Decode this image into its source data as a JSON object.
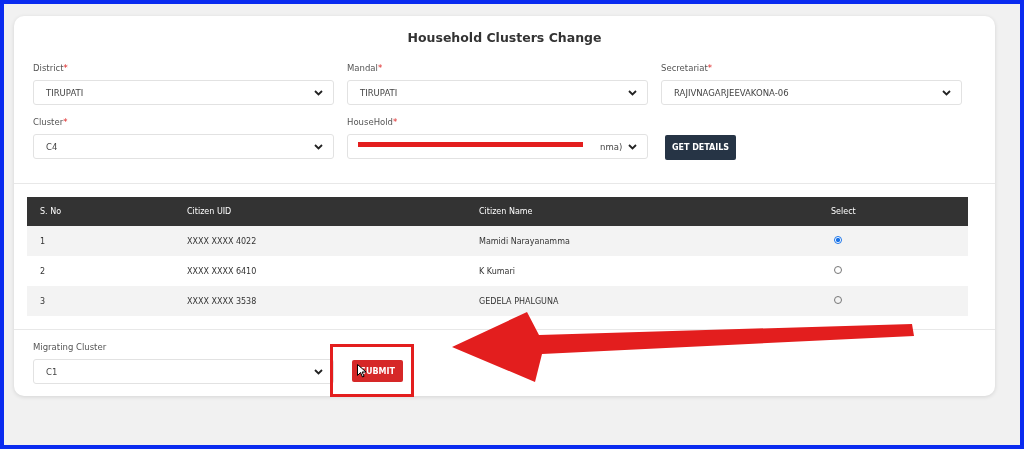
{
  "title": "Household Clusters Change",
  "filters": [
    {
      "label": "District",
      "required_mark": "*",
      "value": "TIRUPATI"
    },
    {
      "label": "Mandal",
      "required_mark": "*",
      "value": "TIRUPATI"
    },
    {
      "label": "Secretariat",
      "required_mark": "*",
      "value": "RAJIVNAGARJEEVAKONA-06"
    },
    {
      "label": "Cluster",
      "required_mark": "*",
      "value": "C4"
    },
    {
      "label": "HouseHold",
      "required_mark": "*",
      "value": "nma)",
      "redacted": true
    }
  ],
  "get_details_button": "GET DETAILS",
  "table": {
    "columns": [
      "S. No",
      "Citizen UID",
      "Citizen Name",
      "Select"
    ],
    "rows": [
      {
        "sno": "1",
        "uid": "XXXX XXXX 4022",
        "name": "Mamidi Narayanamma",
        "selected": true
      },
      {
        "sno": "2",
        "uid": "XXXX XXXX 6410",
        "name": "K Kumari",
        "selected": false
      },
      {
        "sno": "3",
        "uid": "XXXX XXXX 3538",
        "name": "GEDELA PHALGUNA",
        "selected": false
      }
    ]
  },
  "migrating_cluster": {
    "label": "Migrating Cluster",
    "value": "C1"
  },
  "submit_button": "SUBMIT"
}
